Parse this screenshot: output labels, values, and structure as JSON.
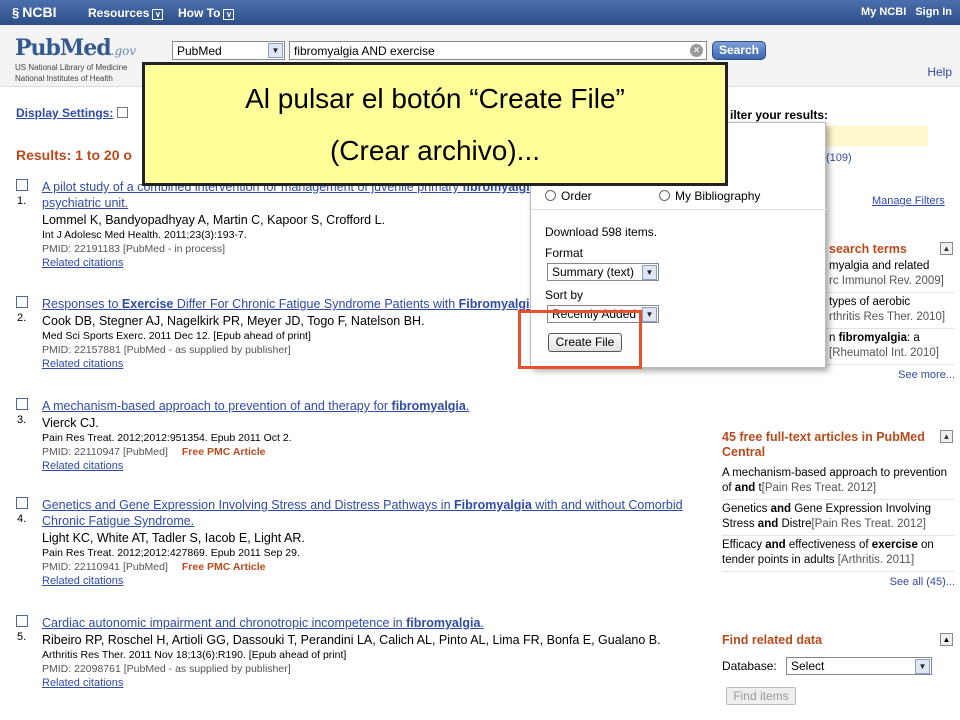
{
  "topbar": {
    "ncbi": "NCBI",
    "menus": [
      "Resources",
      "How To"
    ],
    "my_ncbi": "My NCBI",
    "sign_in": "Sign In"
  },
  "header": {
    "logo_pub": "Pub",
    "logo_med": "Med",
    "logo_gov": ".gov",
    "logo_sub1": "US National Library of Medicine",
    "logo_sub2": "National Institutes of Health",
    "database": "PubMed",
    "query": "fibromyalgia AND exercise",
    "search_label": "Search",
    "help": "Help"
  },
  "display_settings": "Display Settings:",
  "results_count": "Results: 1 to 20 o",
  "results": [
    {
      "num": "1.",
      "title_html": "A pilot study of a combined intervention for management of juvenile primary <b>fibromyalgia</b> in adolescents in an inpatient psychiatric unit.",
      "authors": "Lommel K, Bandyopadhyay A, Martin C, Kapoor S, Crofford L.",
      "journal": "Int J Adolesc Med Health. 2011;23(3):193-7.",
      "pmid": "PMID: 22191183 [PubMed - in process]",
      "pmc": "",
      "related": "Related citations"
    },
    {
      "num": "2.",
      "title_html": "Responses to <b>Exercise</b> Differ For Chronic Fatigue Syndrome Patients with <b>Fibromyalgia</b>.",
      "authors": "Cook DB, Stegner AJ, Nagelkirk PR, Meyer JD, Togo F, Natelson BH.",
      "journal": "Med Sci Sports Exerc. 2011 Dec 12. [Epub ahead of print]",
      "pmid": "PMID: 22157881 [PubMed - as supplied by publisher]",
      "pmc": "",
      "related": "Related citations"
    },
    {
      "num": "3.",
      "title_html": "A mechanism-based approach to prevention of and therapy for <b>fibromyalgia</b>.",
      "authors": "Vierck CJ.",
      "journal": "Pain Res Treat. 2012;2012:951354. Epub 2011 Oct 2.",
      "pmid": "PMID: 22110947 [PubMed]",
      "pmc": "Free PMC Article",
      "related": "Related citations"
    },
    {
      "num": "4.",
      "title_html": "Genetics and Gene Expression Involving Stress and Distress Pathways in <b>Fibromyalgia</b> with and without Comorbid Chronic Fatigue Syndrome.",
      "authors": "Light KC, White AT, Tadler S, Iacob E, Light AR.",
      "journal": "Pain Res Treat. 2012;2012:427869. Epub 2011 Sep 29.",
      "pmid": "PMID: 22110941 [PubMed]",
      "pmc": "Free PMC Article",
      "related": "Related citations"
    },
    {
      "num": "5.",
      "title_html": "Cardiac autonomic impairment and chronotropic incompetence in <b>fibromyalgia</b>.",
      "authors": "Ribeiro RP, Roschel H, Artioli GG, Dassouki T, Perandini LA, Calich AL, Pinto AL, Lima FR, Bonfa E, Gualano B.",
      "journal": "Arthritis Res Ther. 2011 Nov 18;13(6):R190. [Epub ahead of print]",
      "pmid": "PMID: 22098761 [PubMed - as supplied by publisher]",
      "pmc": "",
      "related": "Related citations"
    }
  ],
  "filters": {
    "title": "ilter your results:",
    "count": "109)",
    "manage": "Manage Filters"
  },
  "search_terms": {
    "header": "search terms",
    "items_html": [
      "myalgia</b> and related<br><span class='src'>rc Immunol Rev. 2009]</span>",
      "types of aerobic<br><span class='src'>rthritis Res Ther. 2010]</span>",
      "n <b>fibromyalgia</b>: a<br><span class='src'>[Rheumatol Int. 2010]</span>"
    ],
    "more": "See more..."
  },
  "free_fulltext": {
    "header": "45 free full-text articles in PubMed Central",
    "items_html": [
      "A mechanism-based approach to prevention of <b>and</b> t<span class='src'>[Pain Res Treat. 2012]</span>",
      "Genetics <b>and</b> Gene Expression Involving Stress <b>and</b> Distre<span class='src'>[Pain Res Treat. 2012]</span>",
      "Efficacy <b>and</b> effectiveness of <b>exercise</b> on tender points in adults <span class='src'>[Arthritis. 2011]</span>"
    ],
    "more": "See all (45)..."
  },
  "find_related": {
    "header": "Find related data",
    "database_label": "Database:",
    "database_value": "Select",
    "find_items": "Find items"
  },
  "popup": {
    "radio_order": "Order",
    "radio_bibliography": "My Bibliography",
    "download_text": "Download 598 items.",
    "format_label": "Format",
    "format_value": "Summary (text)",
    "sort_label": "Sort by",
    "sort_value": "Recently Added",
    "create_file": "Create File"
  },
  "callout": {
    "line1": "Al pulsar el botón “Create File”",
    "line2": "(Crear archivo)..."
  },
  "colors": {
    "topbar": "#2d4e86",
    "link": "#2f4ba8",
    "accent_orange": "#b94a1c",
    "highlight": "#e8512a",
    "callout_bg": "#ffff99"
  }
}
